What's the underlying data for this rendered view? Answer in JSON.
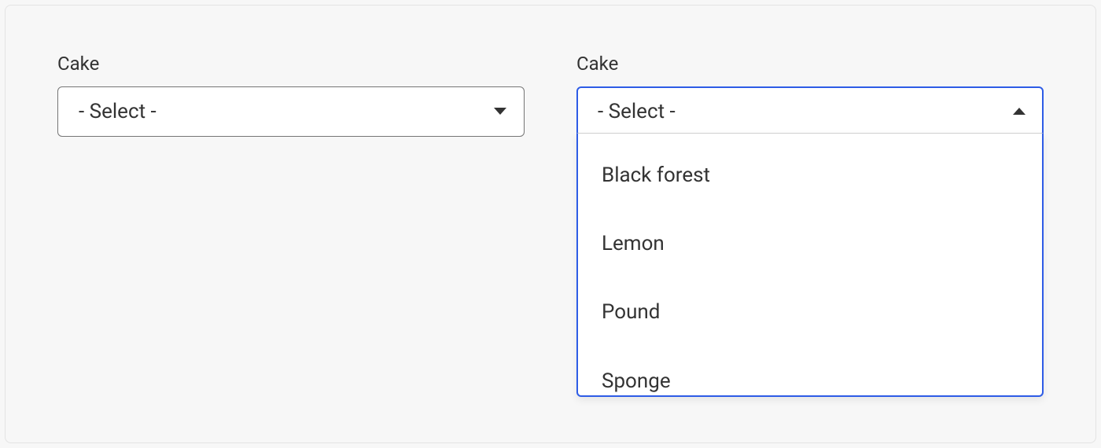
{
  "left": {
    "label": "Cake",
    "placeholder": "- Select -"
  },
  "right": {
    "label": "Cake",
    "placeholder": "- Select -",
    "options": [
      "Black forest",
      "Lemon",
      "Pound",
      "Sponge"
    ]
  }
}
